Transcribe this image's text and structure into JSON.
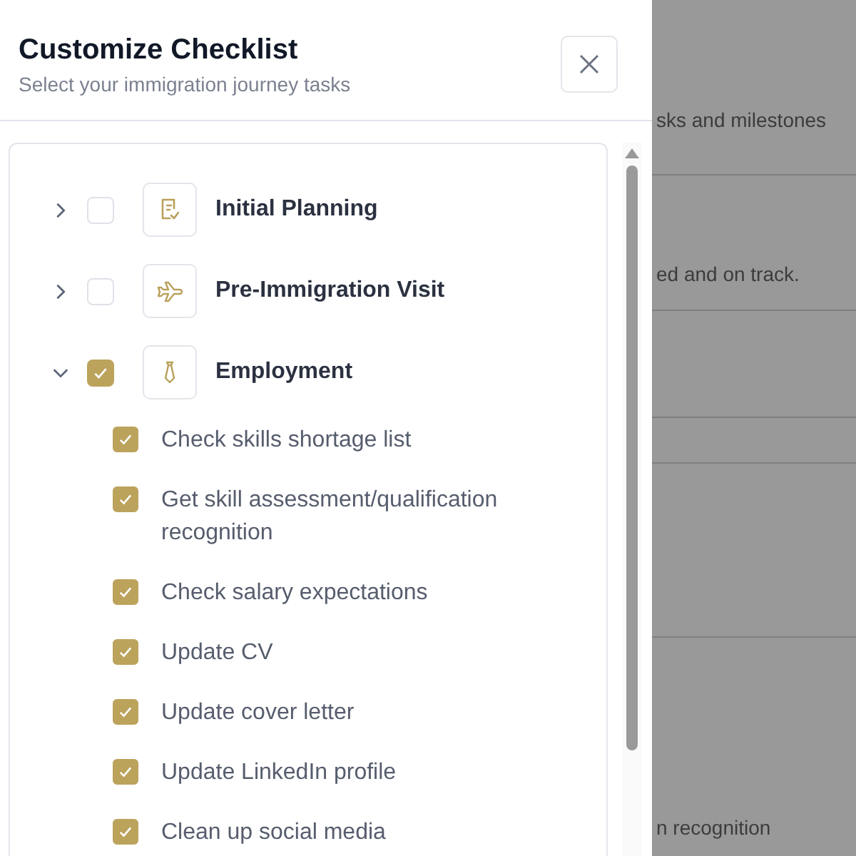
{
  "panel": {
    "title": "Customize Checklist",
    "subtitle": "Select your immigration journey tasks"
  },
  "groups": [
    {
      "label": "Initial Planning",
      "kind": "document",
      "checked": false,
      "expanded": false
    },
    {
      "label": "Pre-Immigration Visit",
      "kind": "plane",
      "checked": false,
      "expanded": false
    },
    {
      "label": "Employment",
      "kind": "tie",
      "checked": true,
      "expanded": true,
      "tasks": [
        {
          "label": "Check skills shortage list",
          "checked": true
        },
        {
          "label": "Get skill assessment/qualification recognition",
          "checked": true
        },
        {
          "label": "Check salary expectations",
          "checked": true
        },
        {
          "label": "Update CV",
          "checked": true
        },
        {
          "label": "Update cover letter",
          "checked": true
        },
        {
          "label": "Update LinkedIn profile",
          "checked": true
        },
        {
          "label": "Clean up social media",
          "checked": true
        }
      ]
    }
  ],
  "background": {
    "texts": [
      "sks and milestones",
      "ed and on track.",
      "n recognition"
    ]
  }
}
